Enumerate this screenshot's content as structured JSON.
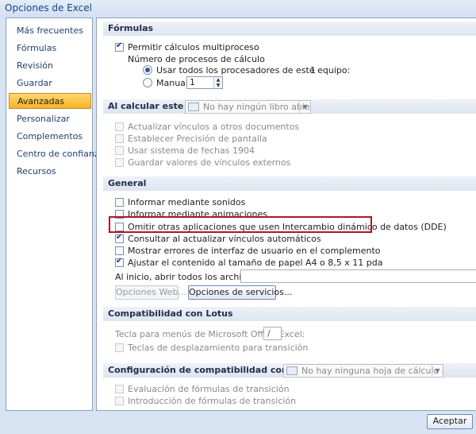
{
  "window": {
    "title": "Opciones de Excel"
  },
  "sidebar": {
    "items": [
      {
        "label": "Más frecuentes"
      },
      {
        "label": "Fórmulas"
      },
      {
        "label": "Revisión"
      },
      {
        "label": "Guardar"
      },
      {
        "label": "Avanzadas",
        "active": true
      },
      {
        "label": "Personalizar"
      },
      {
        "label": "Complementos"
      },
      {
        "label": "Centro de confianza"
      },
      {
        "label": "Recursos"
      }
    ]
  },
  "formulas": {
    "header": "Fórmulas",
    "multithread": {
      "label": "Permitir cálculos multiproceso",
      "checked": true
    },
    "threads_label": "Número de procesos de cálculo",
    "use_all": {
      "label": "Usar todos los procesadores de este equipo:",
      "value": "1",
      "selected": true
    },
    "manual": {
      "label": "Manual",
      "value": "1",
      "selected": false
    }
  },
  "calc_book": {
    "header": "Al calcular este libro:",
    "combo_value": "No hay ningún libro abierto",
    "options": [
      "Actualizar vínculos a otros documentos",
      "Establecer Precisión de pantalla",
      "Usar sistema de fechas 1904",
      "Guardar valores de vínculos externos"
    ]
  },
  "general": {
    "header": "General",
    "options": [
      {
        "label": "Informar mediante sonidos",
        "checked": false
      },
      {
        "label": "Informar mediante animaciones",
        "checked": false
      },
      {
        "label": "Omitir otras aplicaciones que usen Intercambio dinámico de datos (DDE)",
        "checked": false
      },
      {
        "label": "Consultar al actualizar vínculos automáticos",
        "checked": true
      },
      {
        "label": "Mostrar errores de interfaz de usuario en el complemento",
        "checked": false
      },
      {
        "label": "Ajustar el contenido al tamaño de papel A4 o 8,5 x 11 pda",
        "checked": true
      }
    ],
    "startup_label": "Al inicio, abrir todos los archivos en:",
    "startup_value": "",
    "web_options_button": "Opciones Web...",
    "service_options_button": "Opciones de servicios..."
  },
  "lotus": {
    "header": "Compatibilidad con Lotus",
    "menu_key_label": "Tecla para menús de Microsoft Office Excel:",
    "menu_key_value": "/",
    "nav_keys_label": "Teclas de desplazamiento para transición"
  },
  "lotus_settings": {
    "header": "Configuración de compatibilidad con Lotus para:",
    "combo_value": "No hay ninguna hoja de cálculo abierta",
    "options": [
      "Evaluación de fórmulas de transición",
      "Introducción de fórmulas de transición"
    ]
  },
  "footer": {
    "ok_button": "Aceptar"
  }
}
